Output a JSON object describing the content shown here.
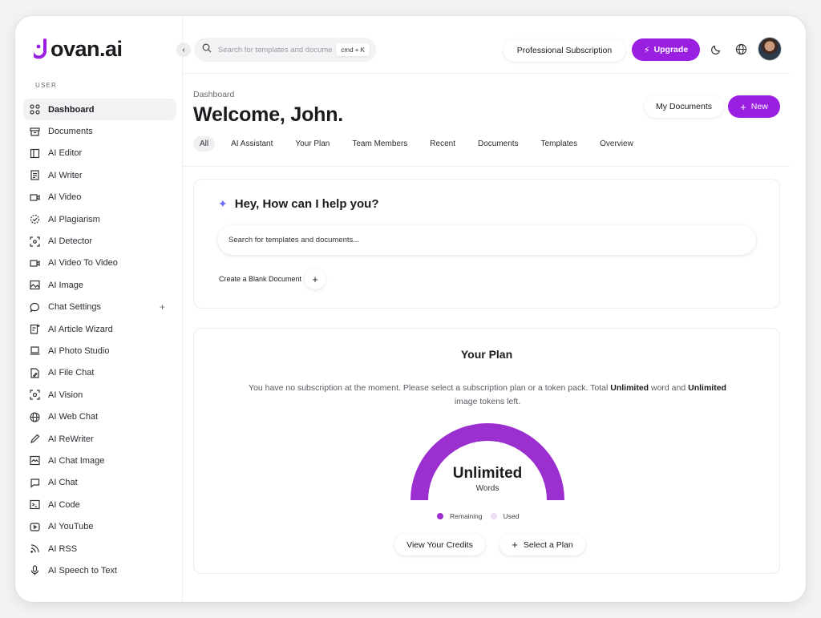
{
  "brand": {
    "name": "ovan.ai",
    "accent": "#9b1fe0"
  },
  "sidebar": {
    "section_label": "USER",
    "items": [
      {
        "label": "Dashboard",
        "icon": "grid-icon",
        "active": true
      },
      {
        "label": "Documents",
        "icon": "archive-icon"
      },
      {
        "label": "AI Editor",
        "icon": "layout-icon"
      },
      {
        "label": "AI Writer",
        "icon": "file-text-icon"
      },
      {
        "label": "AI Video",
        "icon": "video-icon"
      },
      {
        "label": "AI Plagiarism",
        "icon": "check-circle-icon"
      },
      {
        "label": "AI Detector",
        "icon": "scan-icon"
      },
      {
        "label": "AI Video To Video",
        "icon": "video-icon"
      },
      {
        "label": "AI Image",
        "icon": "image-icon"
      },
      {
        "label": "Chat Settings",
        "icon": "chat-bubble-icon",
        "plus": "+"
      },
      {
        "label": "AI Article Wizard",
        "icon": "doc-magic-icon"
      },
      {
        "label": "AI Photo Studio",
        "icon": "laptop-icon"
      },
      {
        "label": "AI File Chat",
        "icon": "file-edit-icon"
      },
      {
        "label": "AI Vision",
        "icon": "eye-scan-icon"
      },
      {
        "label": "AI Web Chat",
        "icon": "www-icon"
      },
      {
        "label": "AI ReWriter",
        "icon": "pen-icon"
      },
      {
        "label": "AI Chat Image",
        "icon": "image-chat-icon"
      },
      {
        "label": "AI Chat",
        "icon": "message-icon"
      },
      {
        "label": "AI Code",
        "icon": "terminal-icon"
      },
      {
        "label": "AI YouTube",
        "icon": "youtube-icon"
      },
      {
        "label": "AI RSS",
        "icon": "rss-icon"
      },
      {
        "label": "AI Speech to Text",
        "icon": "microphone-icon"
      }
    ]
  },
  "topbar": {
    "search_placeholder": "Search for templates and documents...",
    "shortcut": "cmd + K",
    "subscription_label": "Professional Subscription",
    "upgrade_label": "Upgrade"
  },
  "main": {
    "breadcrumb": "Dashboard",
    "title": "Welcome, John.",
    "my_documents_label": "My Documents",
    "new_label": "New",
    "tabs": [
      {
        "label": "All",
        "active": true
      },
      {
        "label": "AI Assistant"
      },
      {
        "label": "Your Plan"
      },
      {
        "label": "Team Members"
      },
      {
        "label": "Recent"
      },
      {
        "label": "Documents"
      },
      {
        "label": "Templates"
      },
      {
        "label": "Overview"
      }
    ]
  },
  "help": {
    "title": "Hey, How can I help you?",
    "search_placeholder": "Search for templates and documents...",
    "blank_doc_label": "Create a Blank Document"
  },
  "plan": {
    "title": "Your Plan",
    "desc_1": "You have no subscription at the moment. Please select a subscription plan or a token pack. Total",
    "desc_bold_1": "Unlimited",
    "desc_2": "word and",
    "desc_bold_2": "Unlimited",
    "desc_3": "image tokens left.",
    "gauge_value": "Unlimited",
    "gauge_unit": "Words",
    "gauge_remaining_fraction": 1.0,
    "legend_remaining": "Remaining",
    "legend_used": "Used",
    "remaining_color": "#9b2fd0",
    "used_color": "#eadcf3",
    "view_credits_label": "View Your Credits",
    "select_plan_label": "Select a Plan"
  }
}
